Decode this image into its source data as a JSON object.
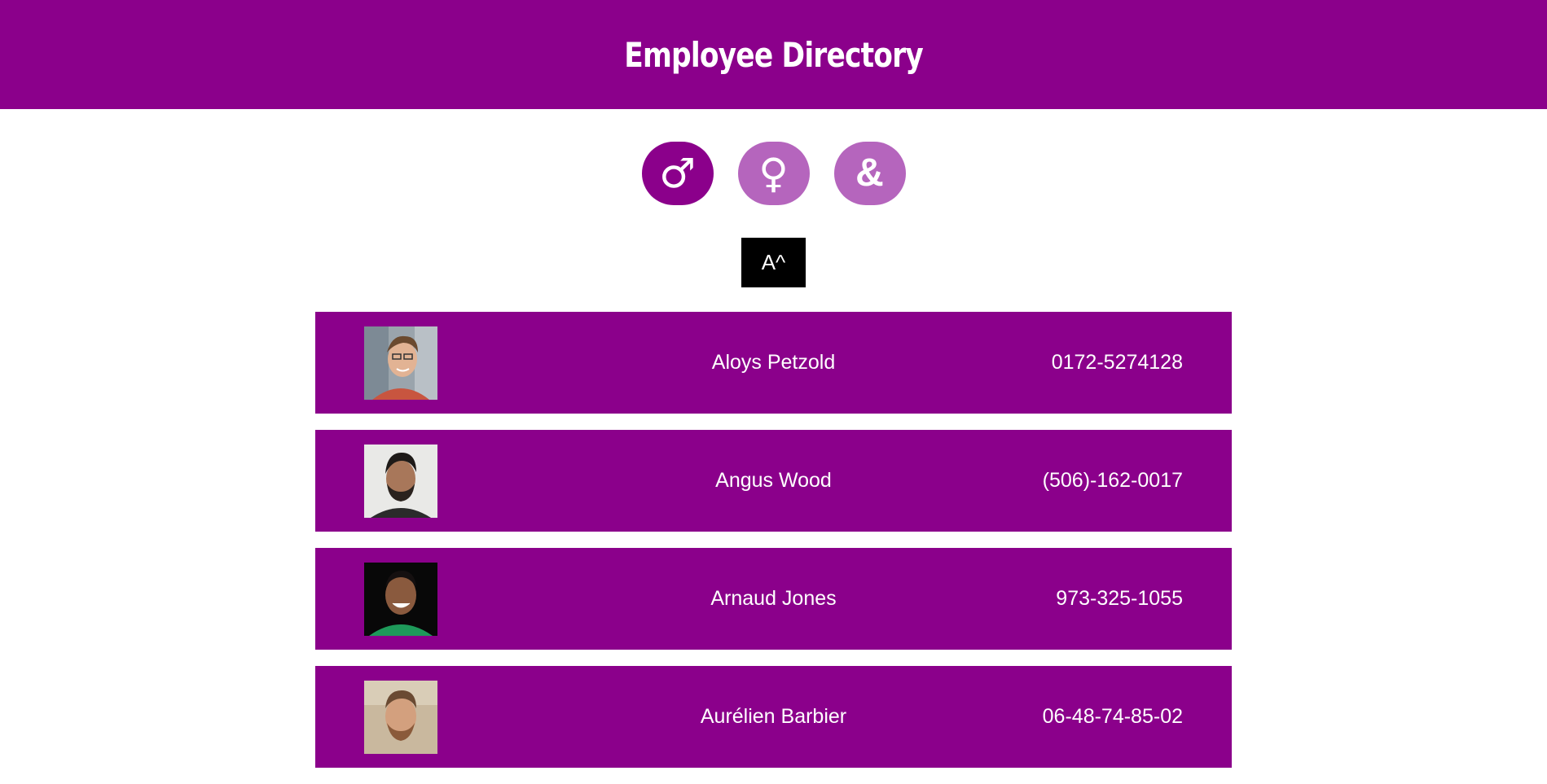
{
  "header": {
    "title": "Employee Directory"
  },
  "filters": {
    "male_glyph": "♂",
    "female_glyph": "♀",
    "all_glyph": "&",
    "active": "male"
  },
  "sort": {
    "label": "A^"
  },
  "colors": {
    "primary": "#8b008b",
    "inactive": "#b565bd",
    "sort_bg": "#000000"
  },
  "employees": [
    {
      "name": "Aloys Petzold",
      "phone": "0172-5274128",
      "avatar": "man-with-glasses-photo"
    },
    {
      "name": "Angus Wood",
      "phone": "(506)-162-0017",
      "avatar": "bearded-man-photo"
    },
    {
      "name": "Arnaud Jones",
      "phone": "973-325-1055",
      "avatar": "smiling-man-green-shirt-photo"
    },
    {
      "name": "Aurélien Barbier",
      "phone": "06-48-74-85-02",
      "avatar": "man-with-beard-outdoor-photo"
    }
  ]
}
